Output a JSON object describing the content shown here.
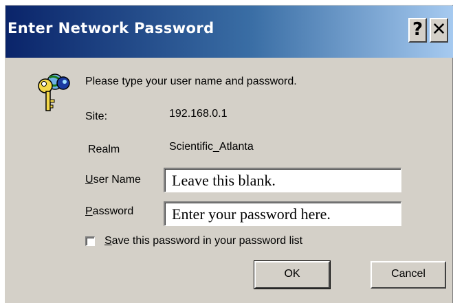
{
  "dialog": {
    "title": "Enter Network Password",
    "help_glyph": "?",
    "close_glyph": "✕",
    "prompt": "Please type your user name and password.",
    "site_label": "Site:",
    "site_value": "192.168.0.1",
    "realm_label": "Realm",
    "realm_value": "Scientific_Atlanta",
    "user_label_mnemonic": "U",
    "user_label_rest": "ser Name",
    "user_value": "Leave this blank.",
    "password_label_mnemonic": "P",
    "password_label_rest": "assword",
    "password_value": "Enter your password here.",
    "save_mnemonic": "S",
    "save_rest": "ave this password in your password list",
    "save_checked": false,
    "ok_label": "OK",
    "cancel_label": "Cancel"
  },
  "icons": {
    "dialog_icon": "keys-icon"
  },
  "colors": {
    "titlebar_start": "#0a246a",
    "titlebar_end": "#a6caf0",
    "window_face": "#d4d0c8"
  }
}
